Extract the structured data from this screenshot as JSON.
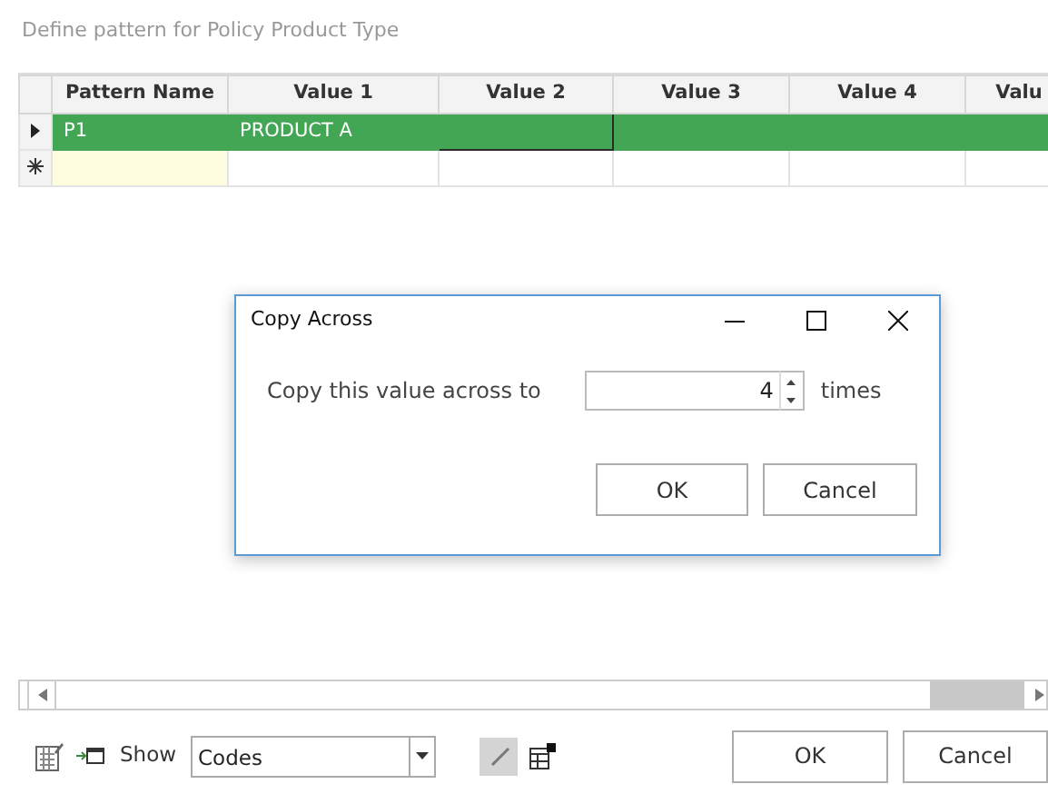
{
  "window": {
    "title": "Define pattern for Policy Product Type"
  },
  "grid": {
    "columns": [
      "Pattern Name",
      "Value 1",
      "Value 2",
      "Value 3",
      "Value 4",
      "Valu"
    ],
    "rows": [
      {
        "kind": "data",
        "selected": true,
        "cells": [
          {
            "text": "P1",
            "current": false
          },
          {
            "text": "PRODUCT A",
            "current": false
          },
          {
            "text": "",
            "current": true
          },
          {
            "text": "",
            "current": false
          },
          {
            "text": "",
            "current": false
          },
          {
            "text": "",
            "current": false
          }
        ]
      },
      {
        "kind": "new",
        "selected": false,
        "cells": [
          {
            "text": "",
            "current": false
          },
          {
            "text": "",
            "current": false
          },
          {
            "text": "",
            "current": false
          },
          {
            "text": "",
            "current": false
          },
          {
            "text": "",
            "current": false
          },
          {
            "text": "",
            "current": false
          }
        ]
      }
    ]
  },
  "dialog": {
    "title": "Copy Across",
    "label": "Copy this value across to",
    "value": "4",
    "unit": "times",
    "buttons": [
      "OK",
      "Cancel"
    ]
  },
  "footer": {
    "show_label": "Show",
    "show_value": "Codes",
    "edit_mode": true,
    "buttons": [
      "OK",
      "Cancel"
    ]
  }
}
